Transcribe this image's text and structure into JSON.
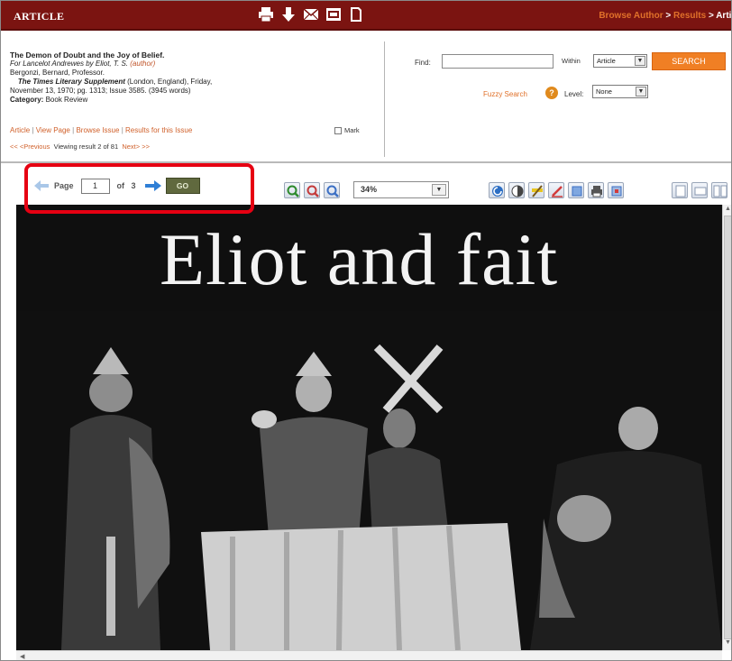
{
  "header": {
    "title": "ARTICLE",
    "breadcrumb": [
      "Browse Author",
      "Results",
      "Artic"
    ],
    "tools": [
      "print-icon",
      "download-icon",
      "email-icon",
      "cite-icon",
      "page-icon"
    ]
  },
  "article": {
    "title": "The Demon of Doubt and the Joy of Belief.",
    "subtitle_prefix": "For Lancelot Andrewes by Eliot, T. S.",
    "subtitle_role": "(author)",
    "author": "Bergonzi, Bernard, Professor.",
    "publication": "The Times Literary Supplement",
    "pub_details_1": "(London, England), Friday,",
    "pub_details_2": "November 13, 1970; pg. 1313; Issue 3585.  (3945 words)",
    "category_label": "Category:",
    "category_value": "Book Review"
  },
  "links": {
    "article": "Article",
    "view_page": "View Page",
    "browse_issue": "Browse Issue",
    "results_issue": "Results for this Issue",
    "mark": "Mark",
    "previous": "<< <Previous",
    "viewing": "Viewing result 2 of 81",
    "next": "Next> >>"
  },
  "search": {
    "find_label": "Find:",
    "find_value": "",
    "within_label": "Within",
    "within_value": "Article",
    "search_button": "SEARCH",
    "fuzzy_label": "Fuzzy Search",
    "level_label": "Level:",
    "level_value": "None"
  },
  "pager": {
    "page_label": "Page",
    "page_value": "1",
    "of_label": "of 3",
    "go_label": "GO"
  },
  "zoom": {
    "value": "34%"
  },
  "viewer": {
    "headline": "Eliot and fait"
  }
}
